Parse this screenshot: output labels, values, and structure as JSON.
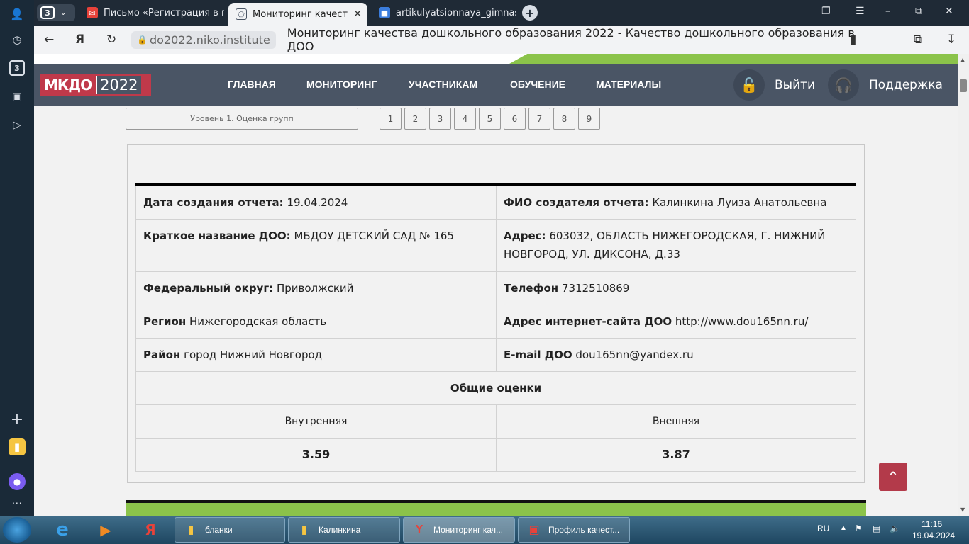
{
  "browser": {
    "tab_count": "3",
    "tabs": [
      {
        "label": "Письмо «Регистрация в п",
        "icon": "mail-icon"
      },
      {
        "label": "Мониторинг качества д",
        "icon": "site-icon"
      },
      {
        "label": "artikulyatsionnaya_gimnas",
        "icon": "cube-icon"
      }
    ],
    "url_host": "do2022.niko.institute",
    "page_title": "Мониторинг качества дошкольного образования 2022 - Качество дошкольного образования в ДОО"
  },
  "site": {
    "logo_left": "МКДО",
    "logo_right": "2022",
    "nav": [
      "ГЛАВНАЯ",
      "МОНИТОРИНГ",
      "УЧАСТНИКАМ",
      "ОБУЧЕНИЕ",
      "МАТЕРИАЛЫ"
    ],
    "logout": "Выйти",
    "support": "Поддержка"
  },
  "level_button": "Уровень 1. Оценка групп",
  "pages": [
    "1",
    "2",
    "3",
    "4",
    "5",
    "6",
    "7",
    "8",
    "9"
  ],
  "report": {
    "created_label": "Дата создания отчета:",
    "created_value": "19.04.2024",
    "author_label": "ФИО создателя отчета:",
    "author_value": "Калинкина Луиза Анатольевна",
    "short_name_label": "Краткое название ДОО:",
    "short_name_value": "МБДОУ ДЕТСКИЙ САД № 165",
    "address_label": "Адрес:",
    "address_value": "603032, ОБЛАСТЬ НИЖЕГОРОДСКАЯ, Г. НИЖНИЙ НОВГОРОД, УЛ. ДИКСОНА, Д.33",
    "district_fed_label": "Федеральный округ:",
    "district_fed_value": "Приволжский",
    "phone_label": "Телефон",
    "phone_value": "7312510869",
    "region_label": "Регион",
    "region_value": "Нижегородская область",
    "site_label": "Адрес интернет-сайта ДОО",
    "site_value": "http://www.dou165nn.ru/",
    "area_label": "Район",
    "area_value": "город Нижний Новгород",
    "email_label": "E-mail ДОО",
    "email_value": "dou165nn@yandex.ru",
    "scores_title": "Общие оценки",
    "internal_label": "Внутренняя",
    "external_label": "Внешняя",
    "internal_value": "3.59",
    "external_value": "3.87"
  },
  "taskbar": {
    "items": [
      {
        "label": "бланки"
      },
      {
        "label": "Калинкина"
      },
      {
        "label": "Мониторинг кач..."
      },
      {
        "label": "Профиль качест..."
      }
    ],
    "lang": "RU",
    "time": "11:16",
    "date": "19.04.2024"
  }
}
